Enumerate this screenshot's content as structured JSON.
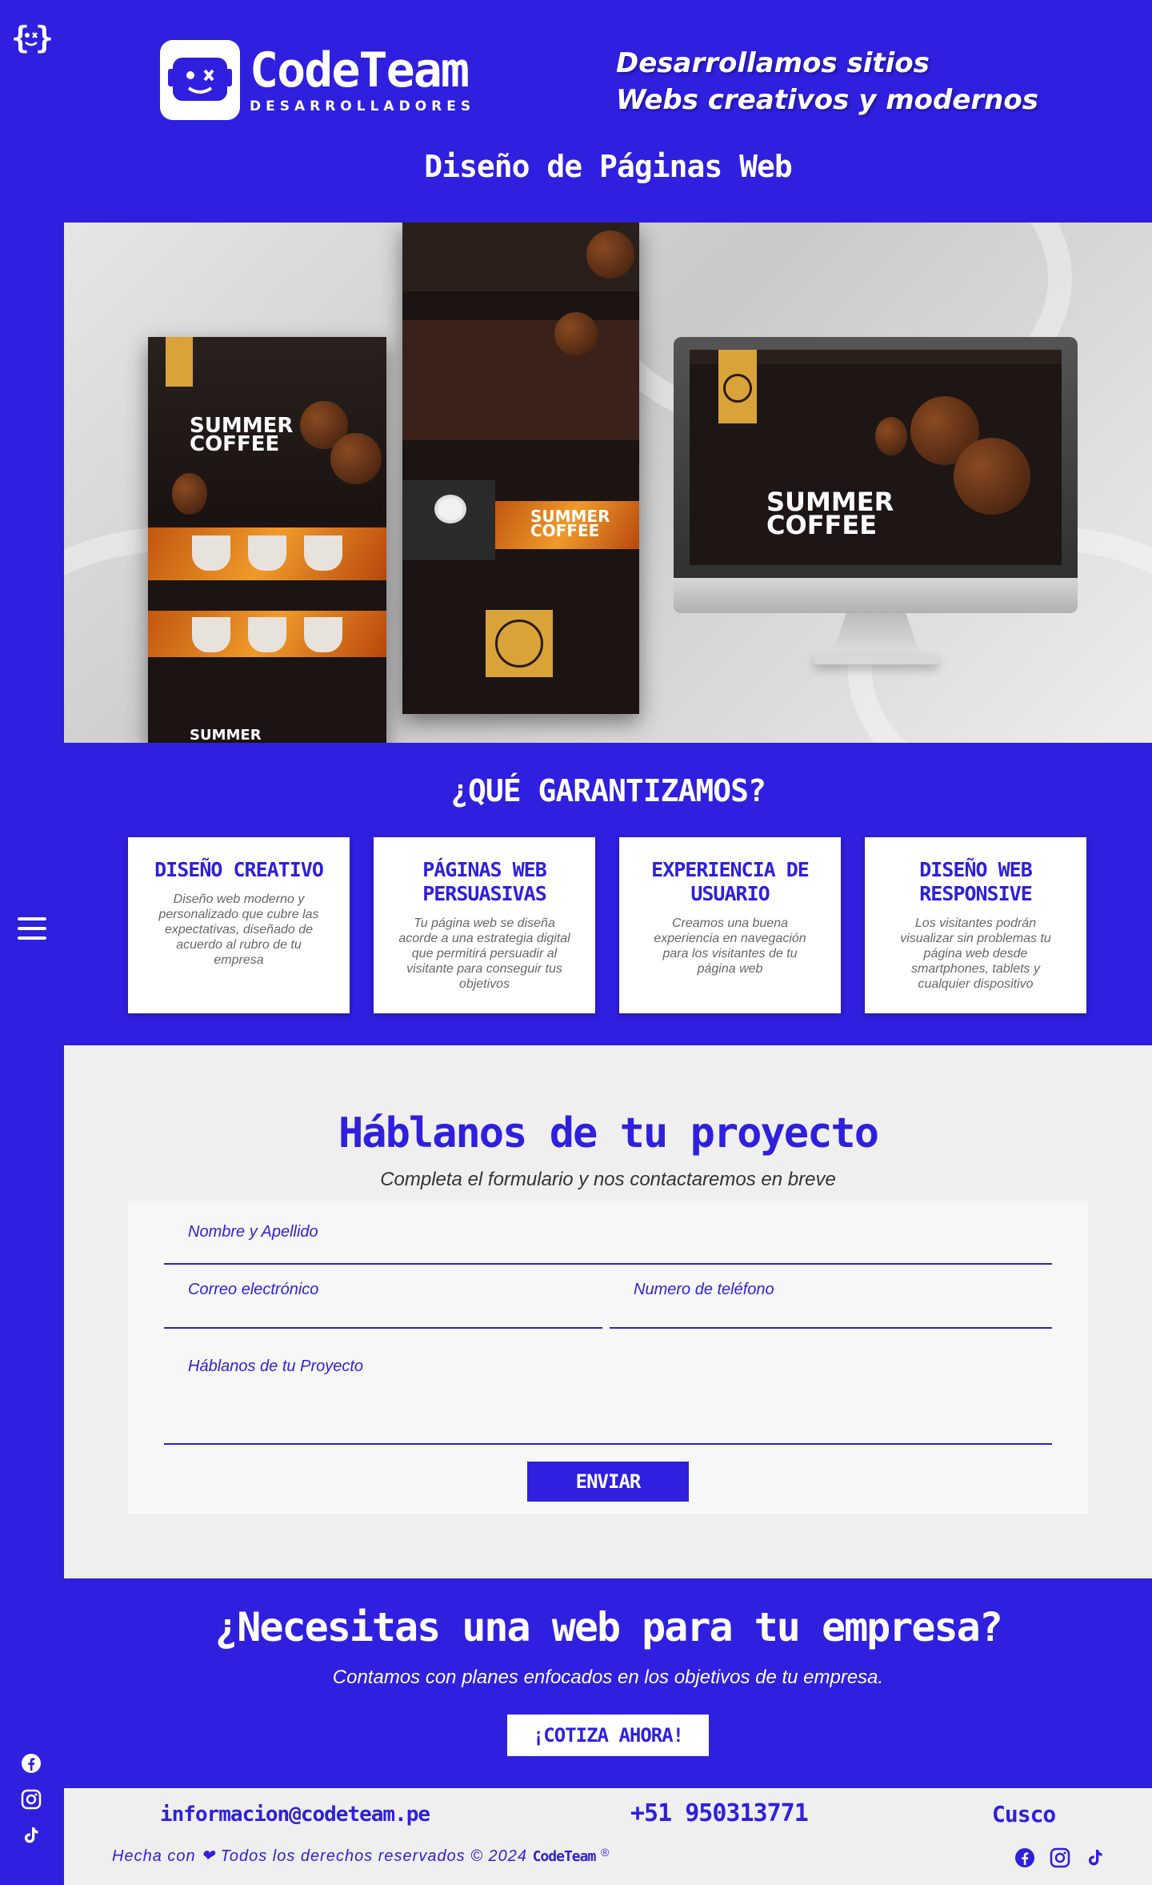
{
  "colors": {
    "brand": "#2f1fde",
    "light": "#efefef",
    "white": "#ffffff"
  },
  "sidebar": {
    "logo_icon": "code-face-icon",
    "menu_icon": "hamburger-menu-icon",
    "social": [
      "facebook-icon",
      "instagram-icon",
      "tiktok-icon"
    ]
  },
  "header": {
    "brand_name": "CodeTeam",
    "brand_sub": "DESARROLLADORES",
    "tagline_line1": "Desarrollamos sitios",
    "tagline_line2": "Webs creativos y modernos",
    "section_title": "Diseño de Páginas Web"
  },
  "hero": {
    "mock_title_line1": "SUMMER",
    "mock_title_line2": "COFFEE",
    "mock_footer_word": "SUMMER"
  },
  "guarantees": {
    "title": "¿QUÉ GARANTIZAMOS?",
    "cards": [
      {
        "title": "DISEÑO CREATIVO",
        "text": "Diseño web moderno y personalizado que cubre las expectativas, diseñado de acuerdo al rubro de tu empresa"
      },
      {
        "title": "PÁGINAS WEB PERSUASIVAS",
        "text": "Tu página web se diseña acorde a una estrategia digital que permitirá persuadir al visitante para conseguir tus objetivos"
      },
      {
        "title": "EXPERIENCIA DE USUARIO",
        "text": "Creamos una buena experiencia en navegación para los visitantes de tu página web"
      },
      {
        "title": "DISEÑO WEB RESPONSIVE",
        "text": "Los visitantes podrán visualizar sin problemas tu página web desde smartphones, tablets y cualquier dispositivo"
      }
    ]
  },
  "contact": {
    "title": "Háblanos de tu proyecto",
    "subtitle": "Completa el formulario y nos contactaremos en breve",
    "name_label": "Nombre y Apellido",
    "email_label": "Correo electrónico",
    "phone_label": "Numero de teléfono",
    "project_label": "Háblanos de tu Proyecto",
    "send_label": "ENVIAR"
  },
  "cta": {
    "title": "¿Necesitas una web para tu empresa?",
    "subtitle": "Contamos con planes enfocados en los objetivos de tu empresa.",
    "button_label": "¡COTIZA AHORA!"
  },
  "footer": {
    "email": "informacion@codeteam.pe",
    "phone": "+51 950313771",
    "city": "Cusco",
    "copyright": "Hecha con ❤ Todos los derechos reservados © 2024",
    "brand": "CodeTeam",
    "registered": "®",
    "social": [
      "facebook-icon",
      "instagram-icon",
      "tiktok-icon"
    ]
  }
}
